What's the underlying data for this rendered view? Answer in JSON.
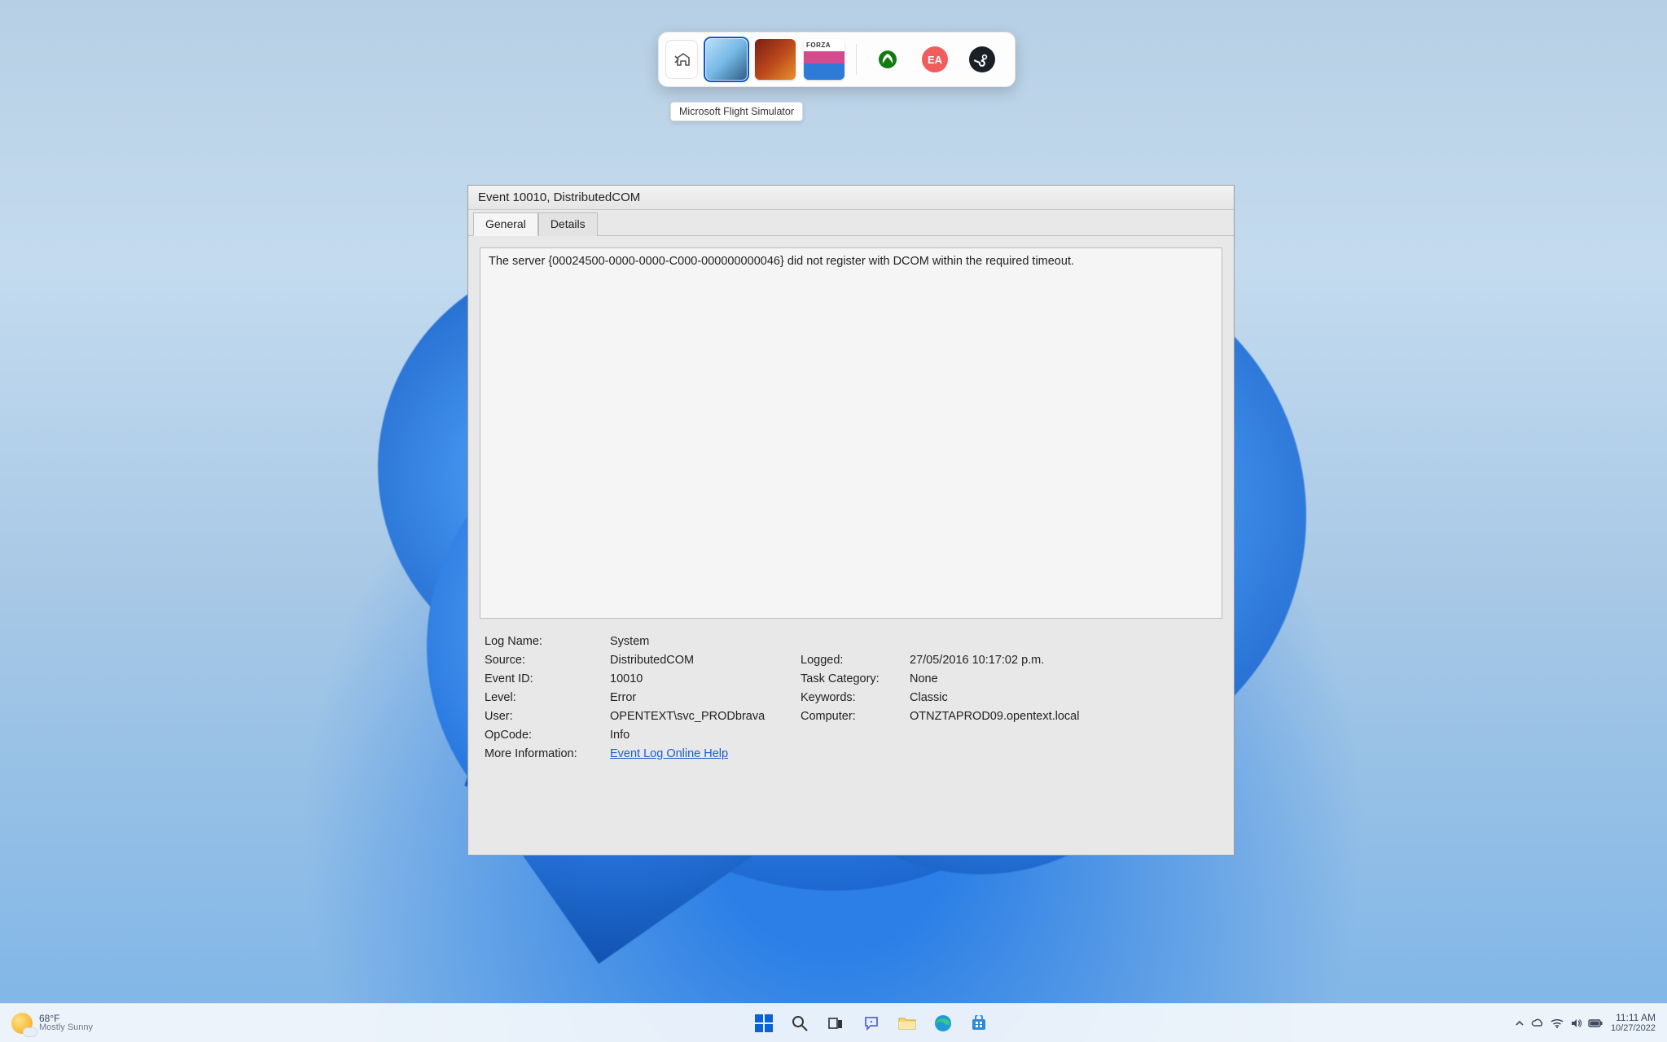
{
  "gamebar": {
    "tooltip": "Microsoft Flight Simulator",
    "tiles": [
      {
        "name": "flight-simulator"
      },
      {
        "name": "minecraft-dungeons"
      },
      {
        "name": "forza-horizon"
      }
    ],
    "launchers": {
      "xbox": "Xbox",
      "ea": "EA",
      "steam": "Steam"
    }
  },
  "event": {
    "title": "Event 10010, DistributedCOM",
    "tabs": {
      "general": "General",
      "details": "Details"
    },
    "message": "The server {00024500-0000-0000-C000-000000000046} did not register with DCOM within the required timeout.",
    "labels": {
      "log_name": "Log Name:",
      "source": "Source:",
      "event_id": "Event ID:",
      "level": "Level:",
      "user": "User:",
      "opcode": "OpCode:",
      "more_info": "More Information:",
      "logged": "Logged:",
      "task_category": "Task Category:",
      "keywords": "Keywords:",
      "computer": "Computer:"
    },
    "values": {
      "log_name": "System",
      "source": "DistributedCOM",
      "event_id": "10010",
      "level": "Error",
      "user": "OPENTEXT\\svc_PRODbrava",
      "opcode": "Info",
      "logged": "27/05/2016 10:17:02 p.m.",
      "task_category": "None",
      "keywords": "Classic",
      "computer": "OTNZTAPROD09.opentext.local",
      "more_info_link": "Event Log Online Help"
    }
  },
  "taskbar": {
    "weather": {
      "temp": "68°F",
      "condition": "Mostly Sunny"
    },
    "clock": {
      "time": "11:11 AM",
      "date": "10/27/2022"
    }
  }
}
